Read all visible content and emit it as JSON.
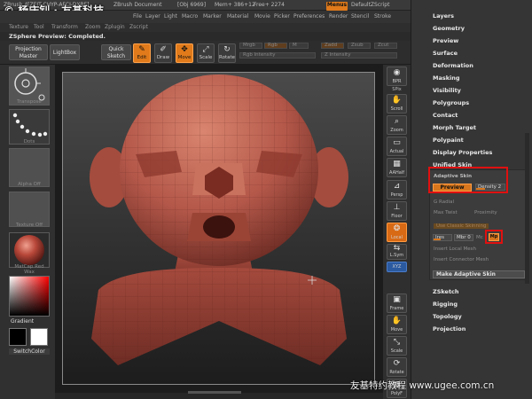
{
  "titlebar": {
    "app": "ZBrush 4[ZEIT-CHYP-AFCJ-DXBF]",
    "document": "ZBrush Document",
    "obj": "[Obj 6969]",
    "mem": "Mem+ 386+12",
    "free": "Free+ 2274",
    "menus": "Menus",
    "script": "DefaultZScript"
  },
  "watermark": "杨庆钊 · 友基科技",
  "menubar": [
    "File",
    "Layer",
    "Light",
    "Macro",
    "Marker",
    "Material",
    "Movie",
    "Picker",
    "Preferences",
    "Render",
    "Stencil",
    "Stroke"
  ],
  "submenubar": [
    "Texture",
    "Tool",
    "Transform",
    "Zoom",
    "Zplugin",
    "Zscript"
  ],
  "status": "ZSphere Preview: Completed.",
  "toolbar": {
    "projection_master": "Projection Master",
    "lightbox": "LightBox",
    "quick_sketch": "Quick Sketch",
    "edit": "Edit",
    "draw": "Draw",
    "move": "Move",
    "scale": "Scale",
    "rotate": "Rotate",
    "mrgb": "Mrgb",
    "rgb": "Rgb",
    "m": "M",
    "zadd": "Zadd",
    "zsub": "Zsub",
    "zcut": "Zcut",
    "rgb_intensity": "Rgb Intensity",
    "z_intensity": "Z Intensity"
  },
  "leftshelf": {
    "brush": "Transpose",
    "dots": "Dots",
    "alpha": "Alpha Off",
    "texture": "Texture Off",
    "material": "MatCap Red Wax",
    "gradient": "Gradient",
    "switchcolor": "SwitchColor"
  },
  "rightshelf": [
    {
      "name": "bpr",
      "label": "BPR"
    },
    {
      "name": "spix",
      "label": "SPix"
    },
    {
      "name": "scroll",
      "label": "Scroll"
    },
    {
      "name": "zoom",
      "label": "Zoom"
    },
    {
      "name": "actual",
      "label": "Actual"
    },
    {
      "name": "aahalf",
      "label": "AAHalf"
    },
    {
      "name": "persp",
      "label": "Persp"
    },
    {
      "name": "floor",
      "label": "Floor"
    },
    {
      "name": "local",
      "label": "Local"
    },
    {
      "name": "lsym",
      "label": "L.Sym"
    },
    {
      "name": "xyz",
      "label": "XYZ"
    },
    {
      "name": "frame",
      "label": "Frame"
    },
    {
      "name": "move",
      "label": "Move"
    },
    {
      "name": "scale",
      "label": "Scale"
    },
    {
      "name": "rotate",
      "label": "Rotate"
    },
    {
      "name": "polyf",
      "label": "PolyF"
    }
  ],
  "palette": {
    "top_items": [
      "Layers",
      "Geometry",
      "Preview",
      "Surface",
      "Deformation",
      "Masking",
      "Visibility",
      "Polygroups",
      "Contact",
      "Morph Target",
      "Polypaint",
      "Display Properties",
      "Unified Skin"
    ],
    "adaptive_skin": {
      "title": "Adaptive Skin",
      "preview": "Preview",
      "density": "Density 2",
      "density_level": 0.3,
      "g_radial": "G Radial",
      "max_twist": "Max Twist",
      "proximity": "Proximity",
      "use_classic": "Use Classic Skinning",
      "ires": "Ires",
      "mbr": "Mbr 0",
      "mc": "Mc",
      "mp": "Mp",
      "insert_local_mesh": "Insert Local Mesh",
      "insert_connector_mesh": "Insert Connector Mesh",
      "make_adaptive_skin": "Make Adaptive Skin"
    },
    "bottom_items": [
      "ZSketch",
      "Rigging",
      "Topology",
      "Projection"
    ]
  },
  "footer_watermark": "友基特约教程   www.ugee.com.cn",
  "colors": {
    "accent_orange": "#e07a1a",
    "highlight_red": "#e01010",
    "model_red": "#b85a4a"
  }
}
